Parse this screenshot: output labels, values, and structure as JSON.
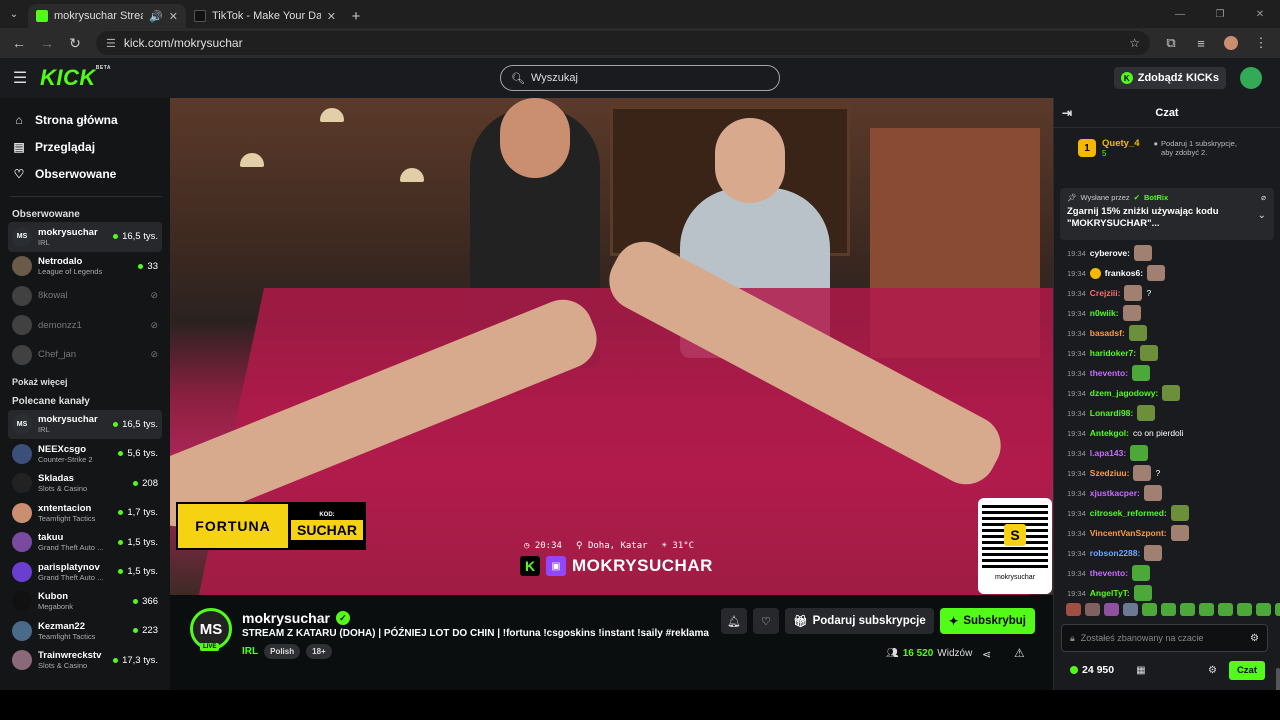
{
  "browser": {
    "tabs": [
      {
        "title": "mokrysuchar Stream - Watc",
        "active": true
      },
      {
        "title": "TikTok - Make Your Day",
        "active": false
      }
    ],
    "url": "kick.com/mokrysuchar"
  },
  "header": {
    "logo": "KICK",
    "logo_sup": "BETA",
    "search_placeholder": "Wyszukaj",
    "kicks_label": "Zdobądź KICKs"
  },
  "sidebar": {
    "nav": [
      {
        "label": "Strona główna",
        "icon": "home-icon"
      },
      {
        "label": "Przeglądaj",
        "icon": "browse-icon"
      },
      {
        "label": "Obserwowane",
        "icon": "heart-icon"
      }
    ],
    "followed_title": "Obserwowane",
    "followed": [
      {
        "name": "mokrysuchar",
        "category": "IRL",
        "viewers": "16,5 tys.",
        "live": true,
        "selected": true,
        "initials": "MS",
        "color": "#2a2d31"
      },
      {
        "name": "Netrodalo",
        "category": "League of Legends",
        "viewers": "33",
        "live": true,
        "selected": false,
        "initials": "",
        "color": "#6a5a4a"
      },
      {
        "name": "8kowal",
        "category": "",
        "viewers": "",
        "live": false,
        "selected": false,
        "initials": "",
        "color": "#777"
      },
      {
        "name": "demonzz1",
        "category": "",
        "viewers": "",
        "live": false,
        "selected": false,
        "initials": "",
        "color": "#777"
      },
      {
        "name": "Chef_jan",
        "category": "",
        "viewers": "",
        "live": false,
        "selected": false,
        "initials": "",
        "color": "#777"
      }
    ],
    "show_more": "Pokaż więcej",
    "recommended_title": "Polecane kanały",
    "recommended": [
      {
        "name": "mokrysuchar",
        "category": "IRL",
        "viewers": "16,5 tys.",
        "initials": "MS",
        "color": "#2a2d31",
        "selected": true
      },
      {
        "name": "NEEXcsgo",
        "category": "Counter-Strike 2",
        "viewers": "5,6 tys.",
        "initials": "",
        "color": "#3a4f7a",
        "selected": false
      },
      {
        "name": "Skladas",
        "category": "Slots & Casino",
        "viewers": "208",
        "initials": "",
        "color": "#222",
        "selected": false
      },
      {
        "name": "xntentacion",
        "category": "Teamfight Tactics",
        "viewers": "1,7 tys.",
        "initials": "",
        "color": "#c98f70",
        "selected": false
      },
      {
        "name": "takuu",
        "category": "Grand Theft Auto ...",
        "viewers": "1,5 tys.",
        "initials": "",
        "color": "#7a4aa0",
        "selected": false
      },
      {
        "name": "parisplatynov",
        "category": "Grand Theft Auto ...",
        "viewers": "1,5 tys.",
        "initials": "",
        "color": "#6a3fd0",
        "selected": false
      },
      {
        "name": "Kubon",
        "category": "Megabonk",
        "viewers": "366",
        "initials": "",
        "color": "#111",
        "selected": false
      },
      {
        "name": "Kezman22",
        "category": "Teamfight Tactics",
        "viewers": "223",
        "initials": "",
        "color": "#4a6a8a",
        "selected": false
      },
      {
        "name": "Trainwreckstv",
        "category": "Slots & Casino",
        "viewers": "17,3 tys.",
        "initials": "",
        "color": "#8a6a7a",
        "selected": false
      }
    ]
  },
  "video": {
    "fortuna_logo": "FORTUNA",
    "fortuna_code_label": "KOD:",
    "fortuna_code": "SUCHAR",
    "overlay_time": "20:34",
    "overlay_location": "Doha, Katar",
    "overlay_temp": "31°C",
    "overlay_name": "MOKRYSUCHAR",
    "qr_label": "mokrysuchar"
  },
  "stream": {
    "avatar_initials": "MS",
    "live_label": "LIVE",
    "username": "mokrysuchar",
    "title": "STREAM Z KATARU (DOHA) | PÓŹNIEJ LOT DO CHIN | !fortuna !csgoskins !instant !saily #reklama",
    "category": "IRL",
    "tags": [
      "Polish",
      "18+"
    ],
    "gift_label": "Podaruj subskrypcje",
    "subscribe_label": "Subskrybuj",
    "viewer_count": "16 520",
    "viewers_word": "Widzów"
  },
  "chat": {
    "title": "Czat",
    "gifter": {
      "rank": "1",
      "name": "Quety_4",
      "count": "5",
      "text_line1": "Podaruj 1 subskrypcje,",
      "text_line2": "aby zdobyć 2."
    },
    "pinned": {
      "sent_by": "Wysłane przez",
      "bot": "BotRix",
      "text": "Zgarnij 15% zniżki używając kodu \"MOKRYSUCHAR\"..."
    },
    "messages": [
      {
        "time": "19:34",
        "user": "cyberove:",
        "color": "#ffffff",
        "text": "",
        "emote": "face"
      },
      {
        "time": "19:34",
        "user": "frankos6:",
        "color": "#ffffff",
        "text": "",
        "emote": "face",
        "badge": true
      },
      {
        "time": "19:34",
        "user": "Crejziii:",
        "color": "#ff6b6b",
        "text": "?",
        "emote": "face"
      },
      {
        "time": "19:34",
        "user": "n0wiik:",
        "color": "#53fc18",
        "text": "",
        "emote": "face"
      },
      {
        "time": "19:34",
        "user": "basadsf:",
        "color": "#ff9a3d",
        "text": "",
        "emote": "frog"
      },
      {
        "time": "19:34",
        "user": "haridoker7:",
        "color": "#53fc18",
        "text": "",
        "emote": "frog"
      },
      {
        "time": "19:34",
        "user": "thevento:",
        "color": "#c86bff",
        "text": "",
        "emote": "pepe"
      },
      {
        "time": "19:34",
        "user": "dzem_jagodowy:",
        "color": "#53fc18",
        "text": "",
        "emote": "frog"
      },
      {
        "time": "19:34",
        "user": "Lonardi98:",
        "color": "#53fc18",
        "text": "",
        "emote": "frog"
      },
      {
        "time": "19:34",
        "user": "Antekgol:",
        "color": "#53fc18",
        "text": "co on pierdoli",
        "emote": ""
      },
      {
        "time": "19:34",
        "user": "l.apa143:",
        "color": "#c86bff",
        "text": "",
        "emote": "pepe"
      },
      {
        "time": "19:34",
        "user": "Szedziuu:",
        "color": "#ff9a3d",
        "text": "?",
        "emote": "face"
      },
      {
        "time": "19:34",
        "user": "xjustkacper:",
        "color": "#c86bff",
        "text": "",
        "emote": "face"
      },
      {
        "time": "19:34",
        "user": "citrosek_reformed:",
        "color": "#53fc18",
        "text": "",
        "emote": "frog"
      },
      {
        "time": "19:34",
        "user": "VincentVanSzpont:",
        "color": "#ff9a3d",
        "text": "",
        "emote": "face"
      },
      {
        "time": "19:34",
        "user": "robson2288:",
        "color": "#6ba8ff",
        "text": "",
        "emote": "face"
      },
      {
        "time": "19:34",
        "user": "thevento:",
        "color": "#c86bff",
        "text": "",
        "emote": "pepe"
      },
      {
        "time": "19:34",
        "user": "AngelTyT:",
        "color": "#53fc18",
        "text": "",
        "emote": "pepe"
      }
    ],
    "input_placeholder": "Zostałeś zbanowany na czacie",
    "points": "24 950",
    "send_label": "Czat"
  }
}
